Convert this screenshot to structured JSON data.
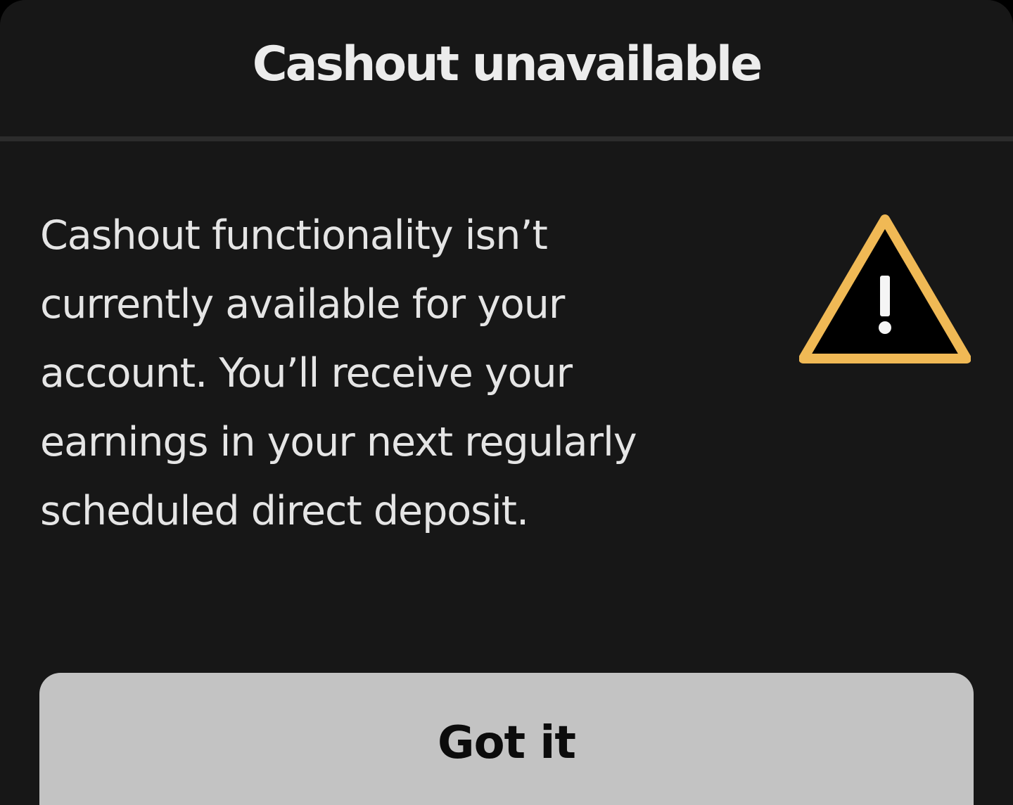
{
  "dialog": {
    "title": "Cashout unavailable",
    "message_lines": [
      "Cashout functionality isn’t",
      "currently available for your",
      "account. You’ll receive your",
      "earnings in your next regularly",
      "scheduled direct deposit."
    ],
    "icon": "warning-triangle-icon",
    "button_label": "Got it"
  },
  "colors": {
    "sheet_background": "#171717",
    "title_text": "#ececec",
    "body_text": "#e5e5e5",
    "divider": "#2c2c2c",
    "warning_yellow": "#f0b955",
    "warning_fill": "#000000",
    "button_background": "#c3c3c3",
    "button_text": "#0c0c0c"
  }
}
